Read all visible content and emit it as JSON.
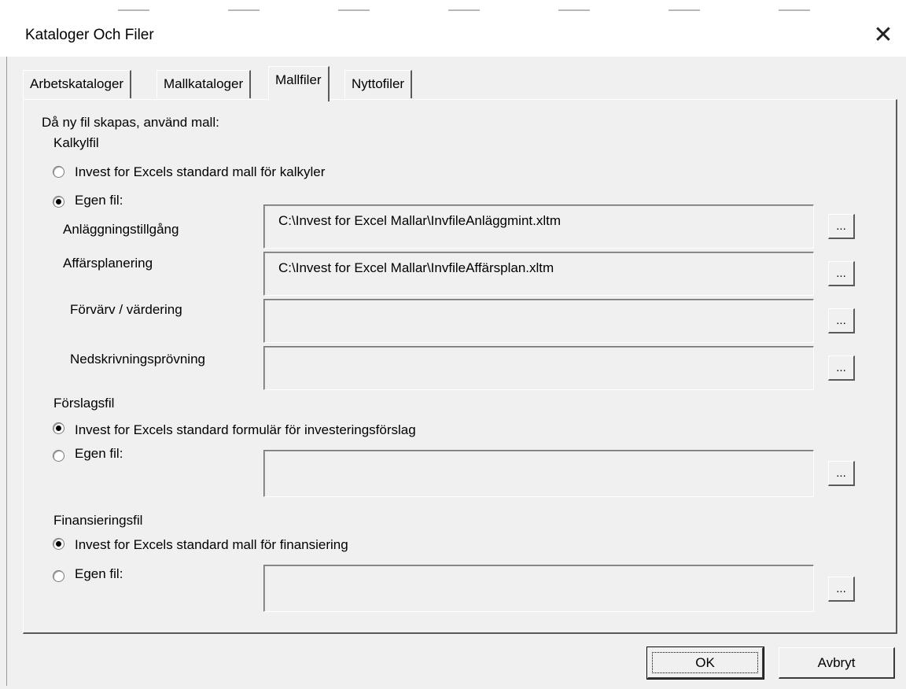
{
  "window": {
    "title": "Kataloger Och Filer",
    "close_glyph": "✕"
  },
  "tabs": [
    {
      "label": "Arbetskataloger",
      "active": false
    },
    {
      "label": "Mallkataloger",
      "active": false
    },
    {
      "label": "Mallfiler",
      "active": true
    },
    {
      "label": "Nyttofiler",
      "active": false
    }
  ],
  "intro": "Då ny fil skapas, använd mall:",
  "kalkyl": {
    "heading": "Kalkylfil",
    "standard_label": "Invest for Excels standard mall för kalkyler",
    "standard_selected": false,
    "own_label": "Egen fil:",
    "own_selected": true,
    "files": [
      {
        "label": "Anläggningstillgång",
        "value": "C:\\Invest for Excel Mallar\\InvfileAnläggmint.xltm"
      },
      {
        "label": "Affärsplanering",
        "value": "C:\\Invest for Excel Mallar\\InvfileAffärsplan.xltm"
      },
      {
        "label": "Förvärv / värdering",
        "value": ""
      },
      {
        "label": "Nedskrivningsprövning",
        "value": ""
      }
    ]
  },
  "forslag": {
    "heading": "Förslagsfil",
    "standard_label": "Invest for Excels standard formulär för investeringsförslag",
    "standard_selected": true,
    "own_label": "Egen fil:",
    "own_selected": false,
    "value": ""
  },
  "finans": {
    "heading": "Finansieringsfil",
    "standard_label": "Invest for Excels standard mall för finansiering",
    "standard_selected": true,
    "own_label": "Egen fil:",
    "own_selected": false,
    "value": ""
  },
  "browse_label": "...",
  "buttons": {
    "ok": "OK",
    "cancel": "Avbryt"
  }
}
